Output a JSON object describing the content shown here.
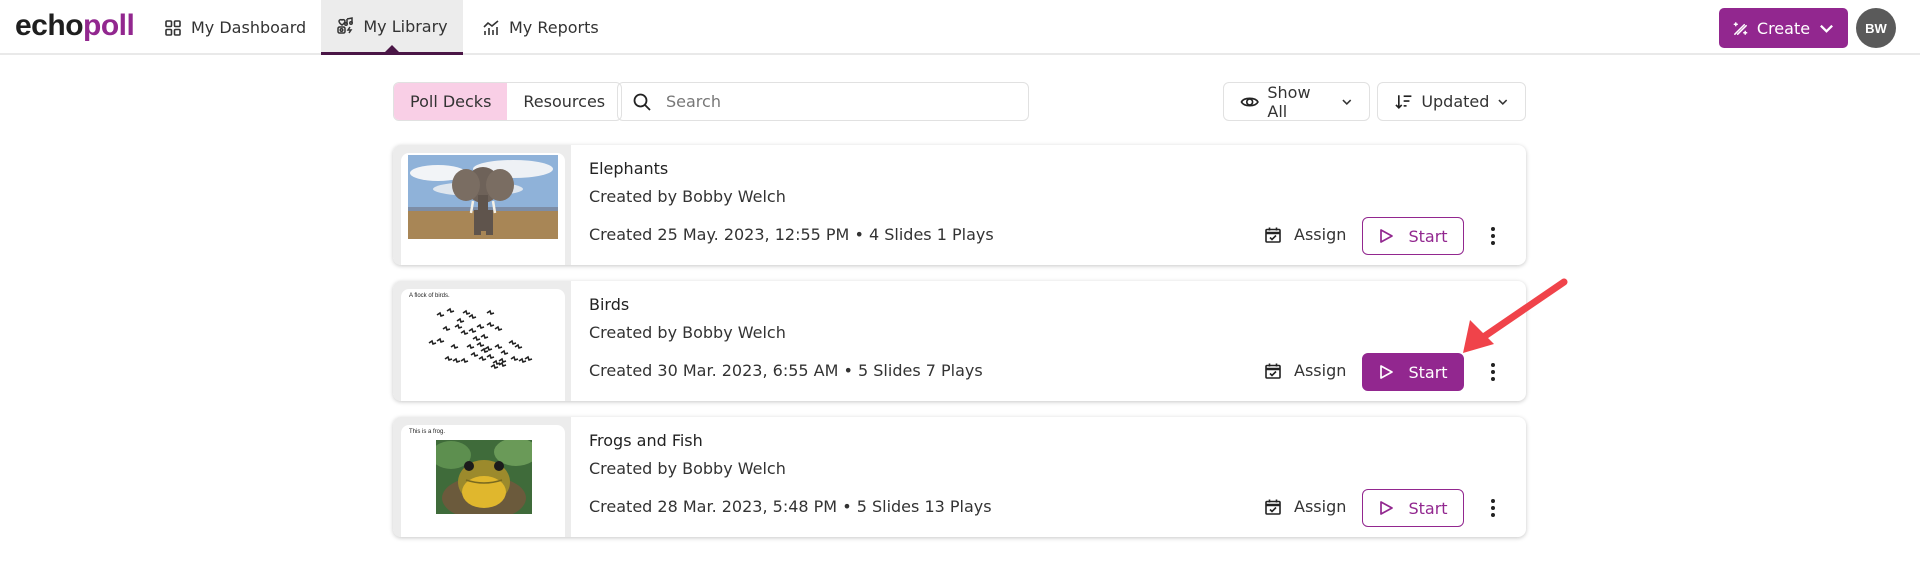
{
  "brand": {
    "logo_part1": "echo",
    "logo_part2": "poll",
    "accent_color": "#92278f"
  },
  "nav": {
    "tabs": [
      {
        "label": "My Dashboard",
        "icon": "dashboard-grid-icon",
        "active": false
      },
      {
        "label": "My Library",
        "icon": "library-icon",
        "active": true
      },
      {
        "label": "My Reports",
        "icon": "reports-chart-icon",
        "active": false
      }
    ],
    "create_label": "Create",
    "avatar_initials": "BW"
  },
  "toolbar": {
    "segments": [
      {
        "label": "Poll Decks",
        "active": true
      },
      {
        "label": "Resources",
        "active": false
      }
    ],
    "search_placeholder": "Search",
    "search_value": "",
    "filter_label": "Show All",
    "sort_label": "Updated"
  },
  "decks": [
    {
      "title": "Elephants",
      "author": "Created by  Bobby Welch",
      "meta": "Created 25 May. 2023, 12:55 PM • 4 Slides 1 Plays",
      "thumb_caption": "",
      "thumb_kind": "elephant",
      "assign_label": "Assign",
      "start_label": "Start",
      "start_highlighted": false
    },
    {
      "title": "Birds",
      "author": "Created by  Bobby Welch",
      "meta": "Created 30 Mar. 2023, 6:55 AM • 5 Slides 7 Plays",
      "thumb_caption": "A flock of birds.",
      "thumb_kind": "birds",
      "assign_label": "Assign",
      "start_label": "Start",
      "start_highlighted": true
    },
    {
      "title": "Frogs and Fish",
      "author": "Created by  Bobby Welch",
      "meta": "Created 28 Mar. 2023, 5:48 PM • 5 Slides 13 Plays",
      "thumb_caption": "This is a frog.",
      "thumb_kind": "frog",
      "assign_label": "Assign",
      "start_label": "Start",
      "start_highlighted": false
    }
  ],
  "annotation": {
    "type": "arrow",
    "color": "#f0434a",
    "points_to": "Birds Start button"
  }
}
